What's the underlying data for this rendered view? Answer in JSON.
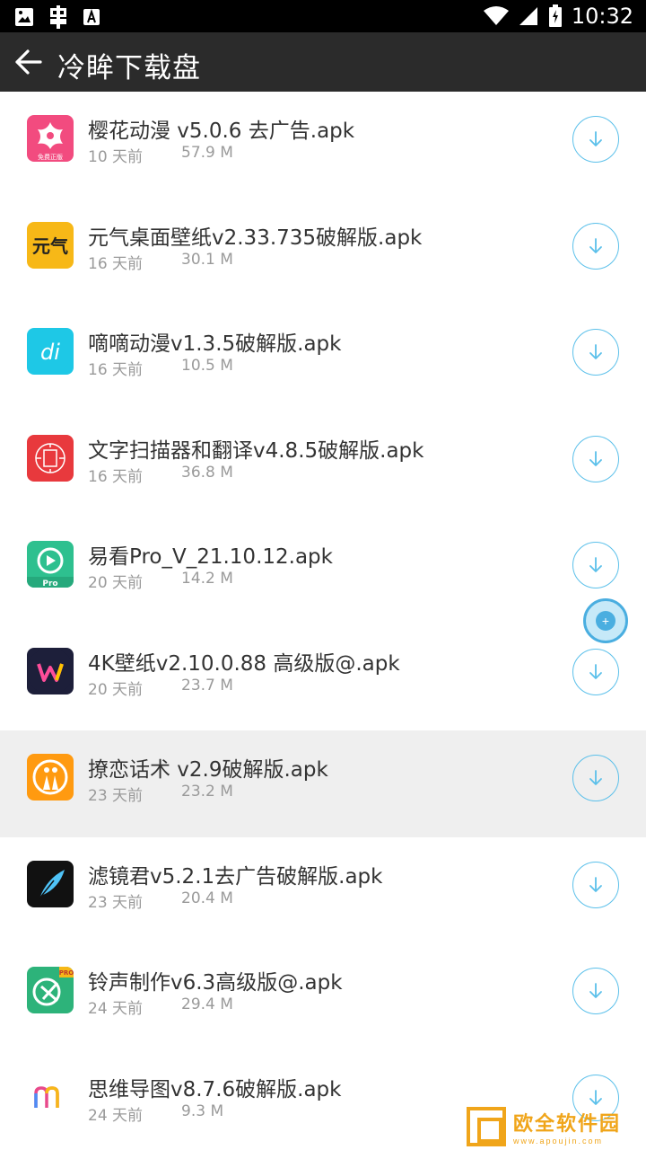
{
  "status_bar": {
    "time": "10:32",
    "left_icons": [
      "image-icon",
      "bug-icon",
      "font-icon"
    ],
    "right_icons": [
      "wifi-icon",
      "signal-icon",
      "battery-icon"
    ]
  },
  "app_bar": {
    "title": "冷眸下载盘",
    "back_icon": "arrow-left-icon"
  },
  "files": [
    {
      "name": "樱花动漫 v5.0.6 去广告.apk",
      "time": "10 天前",
      "size": "57.9 M",
      "icon": "sakura-app-icon",
      "icon_color": "#f24b7f",
      "icon_label": "免费正版"
    },
    {
      "name": "元气桌面壁纸v2.33.735破解版.apk",
      "time": "16 天前",
      "size": "30.1 M",
      "icon": "yuanqi-app-icon",
      "icon_color": "#f7b817",
      "icon_label": "元气"
    },
    {
      "name": "嘀嘀动漫v1.3.5破解版.apk",
      "time": "16 天前",
      "size": "10.5 M",
      "icon": "didi-anime-app-icon",
      "icon_color": "#1ec8e6",
      "icon_label": "di"
    },
    {
      "name": "文字扫描器和翻译v4.8.5破解版.apk",
      "time": "16 天前",
      "size": "36.8 M",
      "icon": "text-scanner-app-icon",
      "icon_color": "#e8393d",
      "icon_label": ""
    },
    {
      "name": "易看Pro_V_21.10.12.apk",
      "time": "20 天前",
      "size": "14.2 M",
      "icon": "yikan-app-icon",
      "icon_color": "#2ec08f",
      "icon_label": "Pro"
    },
    {
      "name": "4K壁纸v2.10.0.88 高级版@.apk",
      "time": "20 天前",
      "size": "23.7 M",
      "icon": "wallpaper-4k-app-icon",
      "icon_color": "#1d1f3a",
      "icon_label": "W"
    },
    {
      "name": "撩恋话术 v2.9破解版.apk",
      "time": "23 天前",
      "size": "23.2 M",
      "icon": "liaolian-app-icon",
      "icon_color": "#ff9a10",
      "icon_label": ""
    },
    {
      "name": "滤镜君v5.2.1去广告破解版.apk",
      "time": "23 天前",
      "size": "20.4 M",
      "icon": "filter-app-icon",
      "icon_color": "#111111",
      "icon_label": ""
    },
    {
      "name": "铃声制作v6.3高级版@.apk",
      "time": "24 天前",
      "size": "29.4 M",
      "icon": "ringtone-app-icon",
      "icon_color": "#2db37a",
      "icon_label": "PRO"
    },
    {
      "name": "思维导图v8.7.6破解版.apk",
      "time": "24 天前",
      "size": "9.3 M",
      "icon": "mindmap-app-icon",
      "icon_color": "#ffffff",
      "icon_label": "m"
    }
  ],
  "selected_index": 6,
  "watermark": {
    "text": "欧全软件园",
    "url": "www.apoujin.com"
  },
  "colors": {
    "status_bar": "#000000",
    "app_bar": "#2b2b2b",
    "accent": "#5bc0ea",
    "selected_row": "#efefef"
  }
}
